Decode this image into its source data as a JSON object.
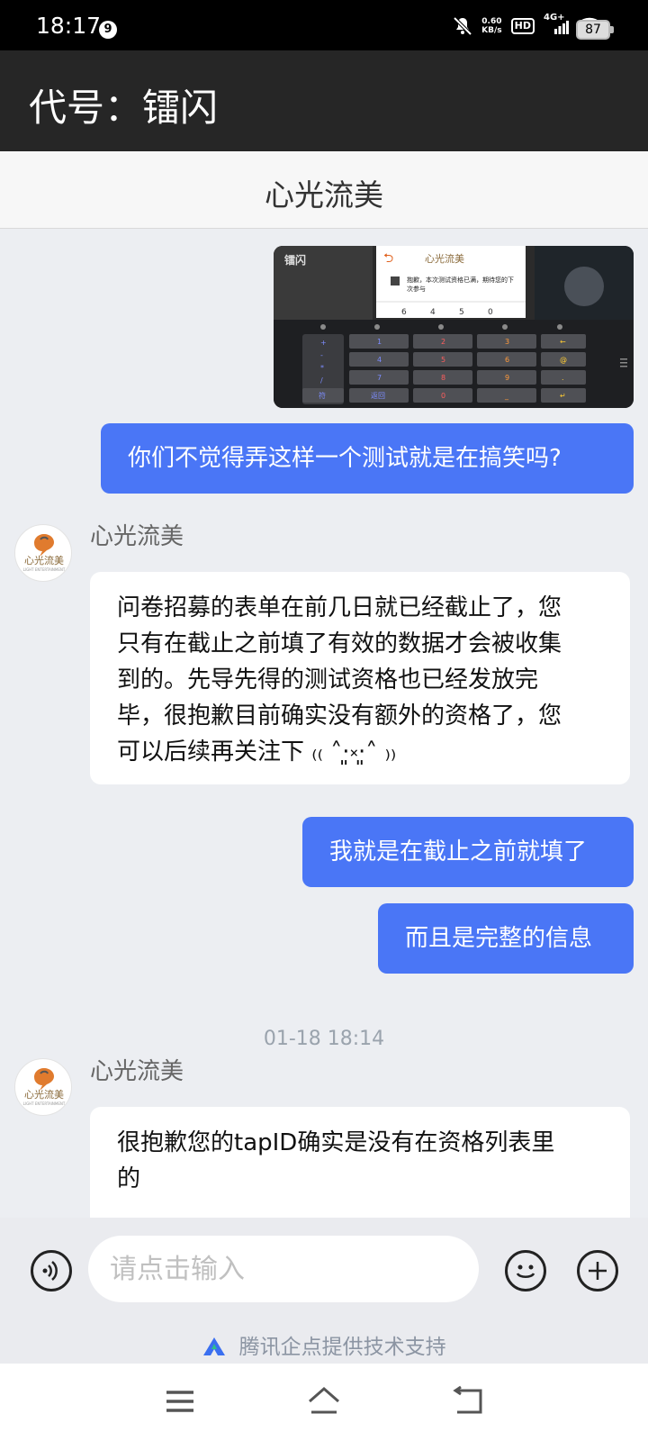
{
  "status_bar": {
    "time": "18:17",
    "notification_count": "9",
    "net_speed_value": "0.60",
    "net_speed_unit": "KB/s",
    "hd_label": "HD",
    "network_label": "4G+",
    "battery": "87"
  },
  "app_header": {
    "title": "代号：镭闪"
  },
  "chat_header": {
    "title": "心光流美"
  },
  "image_message": {
    "dialog_text_1": "抱歉，本次测试资格已满，期待您的下",
    "dialog_text_2": "次参与",
    "code_digits": [
      "6",
      "4",
      "5",
      "0"
    ],
    "keypad_left": [
      "+",
      "-",
      "*",
      "/"
    ],
    "keypad_rows": [
      [
        "1",
        "2",
        "3",
        "←"
      ],
      [
        "4",
        "5",
        "6",
        "@"
      ],
      [
        "7",
        "8",
        "9",
        "."
      ],
      [
        "返回",
        "0",
        "_",
        "↵"
      ]
    ],
    "keypad_corner": "符"
  },
  "messages": {
    "m1": "你们不觉得弄这样一个测试就是在搞笑吗?",
    "sender_1": "心光流美",
    "m2_line1": "问卷招募的表单在前几日就已经截止了，您",
    "m2_line2": "只有在截止之前填了有效的数据才会被收集",
    "m2_line3": "到的。先导先得的测试资格也已经发放完",
    "m2_line4": "毕，很抱歉目前确实没有额外的资格了，您",
    "m2_line5": "可以后续再关注下 ₍₍ ˄·͈༝·͈˄ ₎₎",
    "m3": "我就是在截止之前就填了",
    "m4": "而且是完整的信息",
    "timestamp": "01-18 18:14",
    "sender_2": "心光流美",
    "m5_line1": "很抱歉您的tapID确实是没有在资格列表里",
    "m5_line2": "的"
  },
  "avatar_logo": {
    "text": "心光流美",
    "subtext": "LIGHT ENTERTAINMENT"
  },
  "input_bar": {
    "placeholder": "请点击输入",
    "powered_by": "腾讯企点提供技术支持"
  },
  "icons": {
    "voice": "voice-icon",
    "emoji": "emoji-icon",
    "plus": "plus-icon",
    "menu": "menu-icon",
    "home": "home-icon",
    "back": "back-icon"
  },
  "colors": {
    "accent": "#4a76f6",
    "header_bg": "#262626",
    "chat_bg": "#eceef2"
  }
}
